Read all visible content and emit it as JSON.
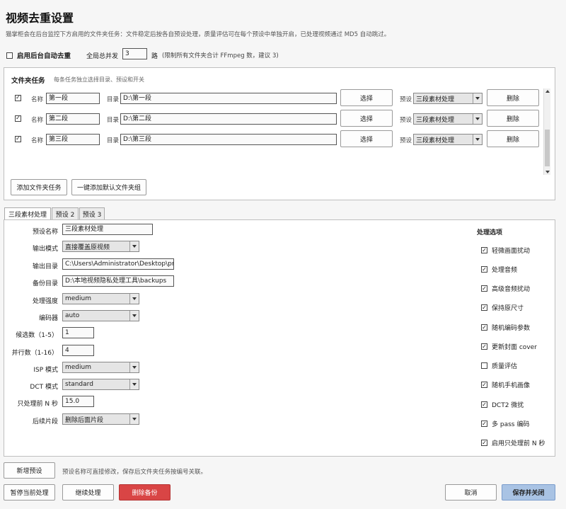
{
  "header": {
    "title": "视频去重设置",
    "subtitle": "猫掌柜会在后台监控下方启用的文件夹任务：文件稳定后按各自预设处理，质量评估可在每个预设中单独开启，已处理视频通过 MD5 自动跳过。"
  },
  "global": {
    "auto_label": "启用后台自动去重",
    "auto_checked": false,
    "concurrency_label": "全局总并发",
    "concurrency_value": "3",
    "concurrency_unit": "路",
    "concurrency_hint": "(限制所有文件夹合计 FFmpeg 数，建议 3)"
  },
  "folder_tasks": {
    "title": "文件夹任务",
    "hint": "每条任务独立选择目录、预设和开关",
    "name_label": "名称",
    "dir_label": "目录",
    "choose_label": "选择",
    "preset_label": "预设",
    "delete_label": "删除",
    "rows": [
      {
        "checked": true,
        "name": "第一段",
        "dir": "D:\\第一段",
        "preset": "三段素材处理"
      },
      {
        "checked": true,
        "name": "第二段",
        "dir": "D:\\第二段",
        "preset": "三段素材处理"
      },
      {
        "checked": true,
        "name": "第三段",
        "dir": "D:\\第三段",
        "preset": "三段素材处理"
      }
    ],
    "add_task_label": "添加文件夹任务",
    "add_default_label": "一键添加默认文件夹组"
  },
  "tabs": [
    "三段素材处理",
    "预设 2",
    "预设 3"
  ],
  "preset": {
    "name_label": "预设名称",
    "name_value": "三段素材处理",
    "output_mode_label": "输出模式",
    "output_mode_value": "直接覆盖原视频",
    "output_dir_label": "输出目录",
    "output_dir_value": "C:\\Users\\Administrator\\Desktop\\prc",
    "backup_dir_label": "备份目录",
    "backup_dir_value": "D:\\本地视频隐私处理工具\\backups",
    "strength_label": "处理强度",
    "strength_value": "medium",
    "encoder_label": "编码器",
    "encoder_value": "auto",
    "candidates_label": "候选数（1-5）",
    "candidates_value": "1",
    "parallel_label": "并行数（1-16）",
    "parallel_value": "4",
    "isp_label": "ISP 模式",
    "isp_value": "medium",
    "dct_label": "DCT 模式",
    "dct_value": "standard",
    "first_n_label": "只处理前 N 秒",
    "first_n_value": "15.0",
    "tail_label": "后续片段",
    "tail_value": "删除后面片段"
  },
  "options": {
    "title": "处理选项",
    "items": [
      {
        "label": "轻微画面扰动",
        "checked": true
      },
      {
        "label": "处理音频",
        "checked": true
      },
      {
        "label": "高级音频扰动",
        "checked": true
      },
      {
        "label": "保持原尺寸",
        "checked": true
      },
      {
        "label": "随机编码参数",
        "checked": true
      },
      {
        "label": "更新封面 cover",
        "checked": true
      },
      {
        "label": "质量评估",
        "checked": false
      },
      {
        "label": "随机手机画像",
        "checked": true
      },
      {
        "label": "DCT2 微扰",
        "checked": true
      },
      {
        "label": "多 pass 编码",
        "checked": true
      },
      {
        "label": "启用只处理前 N 秒",
        "checked": true
      }
    ]
  },
  "footer": {
    "new_preset_label": "新增预设",
    "new_preset_hint": "预设名称可直接修改，保存后文件夹任务按编号关联。",
    "pause_label": "暂停当前处理",
    "continue_label": "继续处理",
    "delete_backup_label": "删除备份",
    "cancel_label": "取消",
    "save_close_label": "保存并关闭"
  },
  "colors": {
    "danger": "#d94545",
    "primary": "#a9c3e4"
  }
}
